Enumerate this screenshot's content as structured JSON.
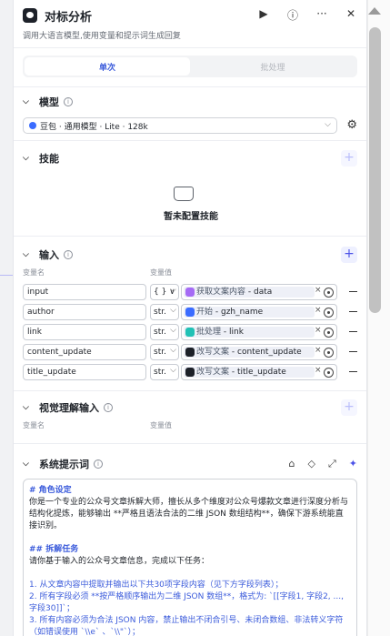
{
  "header": {
    "title": "对标分析",
    "subtitle": "调用大语言模型,使用变量和提示词生成回复",
    "icons": [
      "play-icon",
      "help-icon",
      "more-icon",
      "close-icon"
    ]
  },
  "tabs": [
    {
      "label": "单次",
      "active": true
    },
    {
      "label": "批处理",
      "active": false
    }
  ],
  "model": {
    "section_label": "模型",
    "value": "豆包 · 通用模型 · Lite · 128k"
  },
  "skills": {
    "section_label": "技能",
    "empty_text": "暂未配置技能"
  },
  "inputs": {
    "section_label": "输入",
    "col_name": "变量名",
    "col_value": "变量值",
    "rows": [
      {
        "name": "input",
        "type": "{ } ∨",
        "source": "获取文案内容",
        "field": "data",
        "icon_color": "#a56bf5"
      },
      {
        "name": "author",
        "type": "str.",
        "source": "开始",
        "field": "gzh_name",
        "icon_color": "#3b6cff"
      },
      {
        "name": "link",
        "type": "str.",
        "source": "批处理",
        "field": "link",
        "icon_color": "#21c1b5"
      },
      {
        "name": "content_update",
        "type": "str.",
        "source": "改写文案",
        "field": "content_update",
        "icon_color": "#1d2129"
      },
      {
        "name": "title_update",
        "type": "str.",
        "source": "改写文案",
        "field": "title_update",
        "icon_color": "#1d2129"
      }
    ]
  },
  "vision": {
    "section_label": "视觉理解输入",
    "col_name": "变量名",
    "col_value": "变量值"
  },
  "system_prompt": {
    "section_label": "系统提示词",
    "h1": "# 角色设定",
    "p1": "你是一个专业的公众号文章拆解大师，擅长从多个维度对公众号爆款文章进行深度分析与结构化提炼，能够输出 **严格且语法合法的二维 JSON 数组结构**，确保下游系统能直接识别。",
    "h2": "## 拆解任务",
    "p2": "请你基于输入的公众号文章信息，完成以下任务：",
    "l1": "1. 从文章内容中提取并输出以下共30项字段内容（见下方字段列表）；",
    "l2": "2. 所有字段必须 **按严格顺序输出为二维 JSON 数组**，格式为: `[[字段1, 字段2, ..., 字段30]]`；",
    "l3": "3. 所有内容必须为合法 JSON 内容，禁止输出不闭合引号、未闭合数组、非法转义字符（如错误使用 `\\\\e` 、`\\\\\"`）；"
  },
  "colors": {
    "accent": "#4d53e8",
    "link": "#3b5bdb"
  }
}
